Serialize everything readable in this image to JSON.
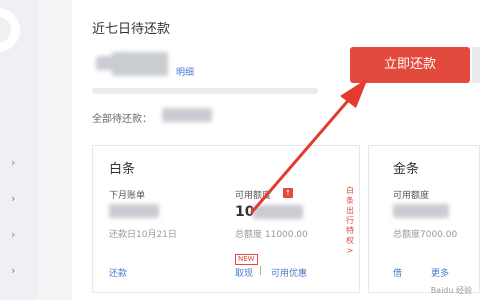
{
  "sidebar": {
    "chevrons": [
      "›",
      "›",
      "›",
      "›"
    ]
  },
  "summary": {
    "title": "近七日待还款",
    "detail_link": "明细",
    "all_due_label": "全部待还款：",
    "repay_button": "立即还款"
  },
  "card_baitiao": {
    "title": "白条",
    "bill_label": "下月账单",
    "due_date": "还款日10月21日",
    "repay_link": "还款",
    "available_label": "可用额度",
    "available_badge": "↑",
    "available_amount_prefix": "10",
    "total_limit": "总额度 11000.00",
    "new_tag": "NEW",
    "cash_link": "取现",
    "separator": "|",
    "coupon_link": "可用优惠",
    "promo_vertical": "白条出行特权 >"
  },
  "card_jintiao": {
    "title": "金条",
    "available_label": "可用额度",
    "total_limit": "总额度7000.00",
    "left_link": "借",
    "right_link": "更多"
  },
  "watermark": "Baidu 经验"
}
